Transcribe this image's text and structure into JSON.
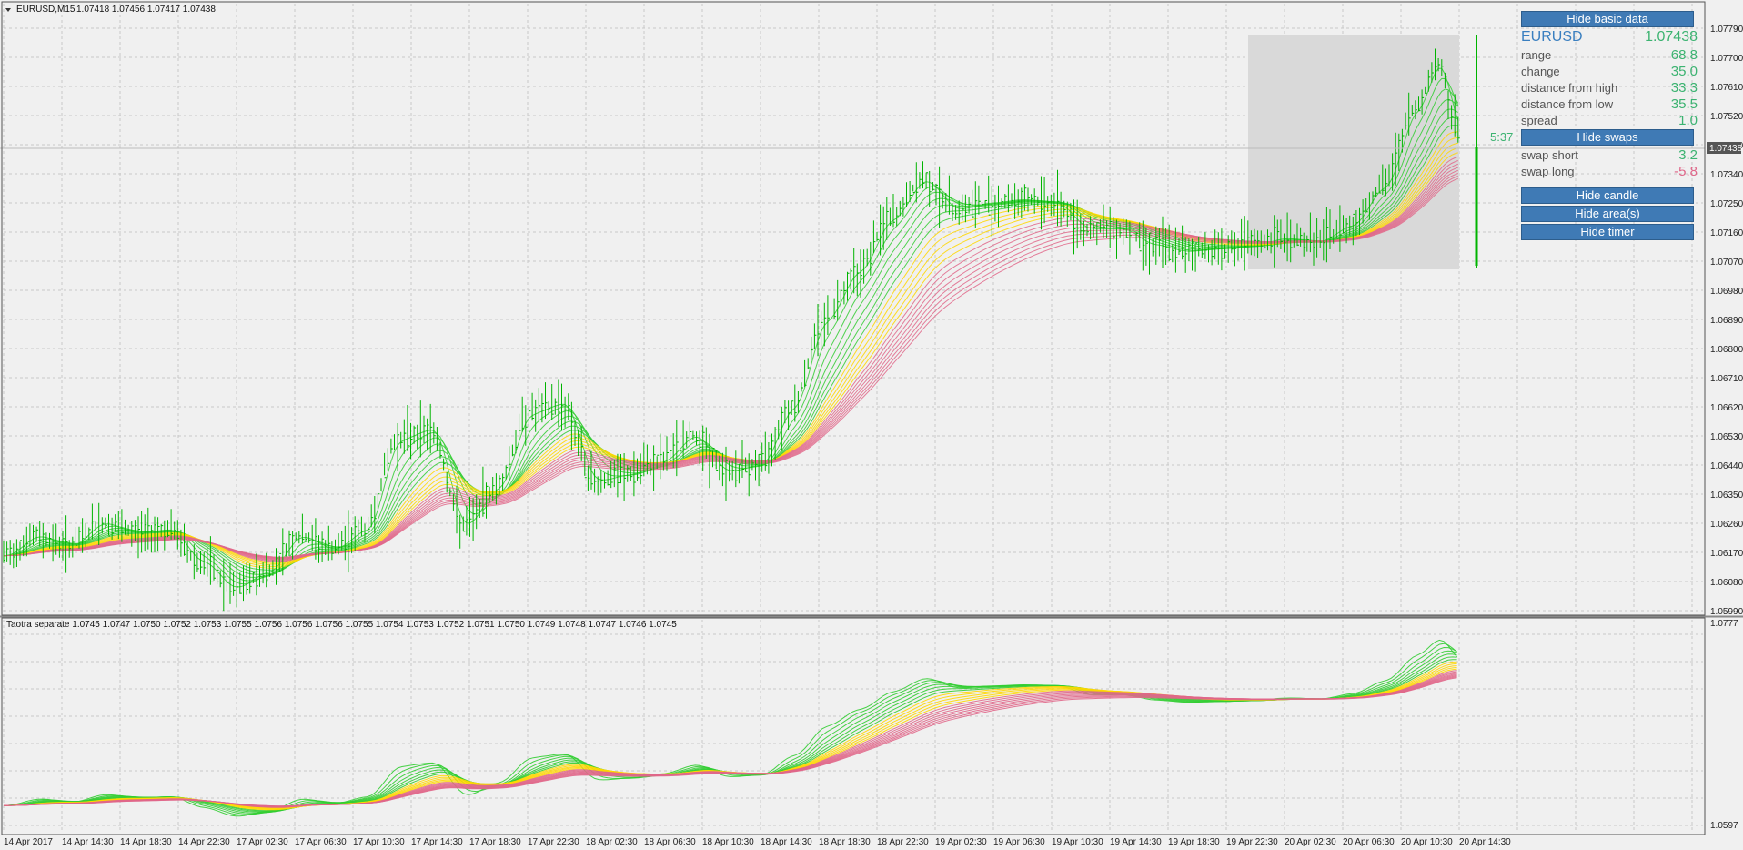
{
  "window": {
    "title": "EURUSD,M15",
    "ohlc": "1.07418 1.07456 1.07417 1.07438"
  },
  "indicator": {
    "title": "Taotra separate 1.0745 1.0747 1.0750 1.0752 1.0753 1.0755 1.0756 1.0756 1.0756 1.0755 1.0754 1.0753 1.0752 1.0751 1.0750 1.0749 1.0748 1.0747 1.0746 1.0745",
    "scale_high": "1.0777",
    "scale_low": "1.0597"
  },
  "price_axis": [
    "1.07790",
    "1.07700",
    "1.07610",
    "1.07520",
    "1.07430",
    "1.07340",
    "1.07250",
    "1.07160",
    "1.07070",
    "1.06980",
    "1.06890",
    "1.06800",
    "1.06710",
    "1.06620",
    "1.06530",
    "1.06440",
    "1.06350",
    "1.06260",
    "1.06170",
    "1.06080",
    "1.05990"
  ],
  "current_price_label": "1.07438",
  "time_axis": [
    "14 Apr 2017",
    "14 Apr 14:30",
    "14 Apr 18:30",
    "14 Apr 22:30",
    "17 Apr 02:30",
    "17 Apr 06:30",
    "17 Apr 10:30",
    "17 Apr 14:30",
    "17 Apr 18:30",
    "17 Apr 22:30",
    "18 Apr 02:30",
    "18 Apr 06:30",
    "18 Apr 10:30",
    "18 Apr 14:30",
    "18 Apr 18:30",
    "18 Apr 22:30",
    "19 Apr 02:30",
    "19 Apr 06:30",
    "19 Apr 10:30",
    "19 Apr 14:30",
    "19 Apr 18:30",
    "19 Apr 22:30",
    "20 Apr 02:30",
    "20 Apr 06:30",
    "20 Apr 10:30",
    "20 Apr 14:30"
  ],
  "timer": "5:37",
  "panel": {
    "hide_basic_data": "Hide basic data",
    "symbol": "EURUSD",
    "price": "1.07438",
    "rows": [
      {
        "label": "range",
        "value": "68.8"
      },
      {
        "label": "change",
        "value": "35.0"
      },
      {
        "label": "distance from high",
        "value": "33.3"
      },
      {
        "label": "distance from low",
        "value": "35.5"
      },
      {
        "label": "spread",
        "value": "1.0"
      }
    ],
    "hide_swaps": "Hide swaps",
    "swaps": [
      {
        "label": "swap short",
        "value": "3.2"
      },
      {
        "label": "swap long",
        "value": "-5.8"
      }
    ],
    "hide_candle": "Hide candle",
    "hide_areas": "Hide area(s)",
    "hide_timer": "Hide timer"
  },
  "colors": {
    "background": "#f0f0f0",
    "bullish_bar": "#00b400",
    "ribbon_fast": "#32cd32",
    "ribbon_mid": "#ffd700",
    "ribbon_slow": "#e0678a",
    "button": "#3f7ab5",
    "positive": "#3cb371",
    "negative": "#e0678a"
  },
  "chart_data": {
    "type": "line",
    "series_key_prices": [
      [
        0,
        1.0616
      ],
      [
        30,
        1.0622
      ],
      [
        60,
        1.0619
      ],
      [
        90,
        1.0626
      ],
      [
        120,
        1.0623
      ],
      [
        150,
        1.0624
      ],
      [
        180,
        1.0614
      ],
      [
        210,
        1.0606
      ],
      [
        240,
        1.0611
      ],
      [
        270,
        1.0622
      ],
      [
        300,
        1.0618
      ],
      [
        330,
        1.0624
      ],
      [
        360,
        1.0652
      ],
      [
        390,
        1.0655
      ],
      [
        420,
        1.0625
      ],
      [
        450,
        1.0637
      ],
      [
        480,
        1.066
      ],
      [
        510,
        1.0663
      ],
      [
        540,
        1.0639
      ],
      [
        570,
        1.0641
      ],
      [
        600,
        1.0645
      ],
      [
        630,
        1.0653
      ],
      [
        660,
        1.0642
      ],
      [
        690,
        1.0644
      ],
      [
        720,
        1.0662
      ],
      [
        750,
        1.0689
      ],
      [
        780,
        1.0704
      ],
      [
        810,
        1.072
      ],
      [
        840,
        1.0732
      ],
      [
        870,
        1.0723
      ],
      [
        900,
        1.0725
      ],
      [
        930,
        1.0726
      ],
      [
        960,
        1.0725
      ],
      [
        990,
        1.0717
      ],
      [
        1020,
        1.0717
      ],
      [
        1050,
        1.0712
      ],
      [
        1080,
        1.071
      ],
      [
        1110,
        1.0711
      ],
      [
        1140,
        1.0712
      ],
      [
        1170,
        1.0714
      ],
      [
        1200,
        1.0713
      ],
      [
        1230,
        1.0718
      ],
      [
        1260,
        1.073
      ],
      [
        1290,
        1.0754
      ],
      [
        1310,
        1.0768
      ],
      [
        1330,
        1.0747
      ]
    ],
    "ylim": [
      1.0599,
      1.0779
    ]
  }
}
